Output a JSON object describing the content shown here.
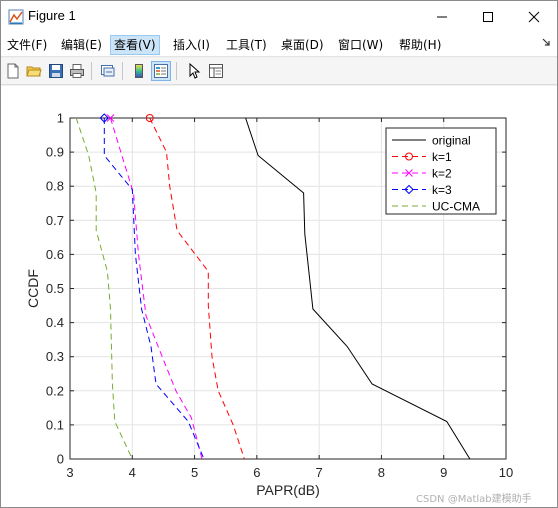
{
  "window": {
    "title": "Figure 1",
    "colors": {
      "title_bg": "#ffffff",
      "menu_active_bg": "#cce4f7"
    }
  },
  "menubar": {
    "items": [
      {
        "label": "文件(F)",
        "active": false
      },
      {
        "label": "编辑(E)",
        "active": false
      },
      {
        "label": "查看(V)",
        "active": true
      },
      {
        "label": "插入(I)",
        "active": false
      },
      {
        "label": "工具(T)",
        "active": false
      },
      {
        "label": "桌面(D)",
        "active": false
      },
      {
        "label": "窗口(W)",
        "active": false
      },
      {
        "label": "帮助(H)",
        "active": false
      }
    ],
    "overflow_icon": "dock-arrow-icon"
  },
  "toolbar": {
    "buttons": [
      {
        "icon": "new-figure-icon"
      },
      {
        "icon": "open-file-icon"
      },
      {
        "icon": "save-icon"
      },
      {
        "icon": "print-icon"
      },
      {
        "icon": "link-plot-icon"
      },
      {
        "icon": "colorbar-icon"
      },
      {
        "icon": "legend-icon",
        "pressed": true
      },
      {
        "icon": "pointer-icon"
      },
      {
        "icon": "property-inspector-icon"
      }
    ]
  },
  "chart_data": {
    "type": "line",
    "title": "",
    "xlabel": "PAPR(dB)",
    "ylabel": "CCDF",
    "xlim": [
      3,
      10
    ],
    "ylim": [
      0,
      1
    ],
    "xticks": [
      "3",
      "4",
      "5",
      "6",
      "7",
      "8",
      "9",
      "10"
    ],
    "yticks": [
      "0",
      "0.1",
      "0.2",
      "0.3",
      "0.4",
      "0.5",
      "0.6",
      "0.7",
      "0.8",
      "0.9",
      "1"
    ],
    "grid": true,
    "legend_position": "top-right",
    "series": [
      {
        "name": "original",
        "color": "#000000",
        "dash": "solid",
        "marker": "none",
        "x": [
          5.82,
          6.02,
          6.75,
          6.77,
          6.9,
          7.45,
          7.85,
          9.05,
          9.42
        ],
        "y": [
          1.0,
          0.89,
          0.78,
          0.66,
          0.44,
          0.33,
          0.22,
          0.11,
          0.0
        ]
      },
      {
        "name": "k=1",
        "color": "#ff0000",
        "dash": "dashed",
        "marker": "circle",
        "x": [
          4.28,
          4.55,
          4.6,
          4.72,
          5.22,
          5.22,
          5.28,
          5.38,
          5.62,
          5.8
        ],
        "y": [
          1.0,
          0.9,
          0.8,
          0.67,
          0.55,
          0.45,
          0.3,
          0.2,
          0.1,
          0.0
        ]
      },
      {
        "name": "k=2",
        "color": "#ff00ff",
        "dash": "dashed",
        "marker": "x",
        "x": [
          3.65,
          3.85,
          4.02,
          4.1,
          4.22,
          4.48,
          4.7,
          4.95,
          5.12
        ],
        "y": [
          1.0,
          0.88,
          0.78,
          0.6,
          0.42,
          0.3,
          0.2,
          0.12,
          0.0
        ]
      },
      {
        "name": "k=3",
        "color": "#0000ff",
        "dash": "dashed",
        "marker": "diamond",
        "x": [
          3.55,
          3.55,
          4.0,
          4.05,
          4.15,
          4.3,
          4.38,
          4.9,
          5.15
        ],
        "y": [
          1.0,
          0.89,
          0.79,
          0.6,
          0.44,
          0.33,
          0.22,
          0.11,
          0.0
        ]
      },
      {
        "name": "UC-CMA",
        "color": "#77ac30",
        "dash": "dashed",
        "marker": "none",
        "x": [
          3.1,
          3.3,
          3.42,
          3.42,
          3.6,
          3.65,
          3.68,
          3.72,
          4.0
        ],
        "y": [
          1.0,
          0.89,
          0.78,
          0.67,
          0.55,
          0.44,
          0.22,
          0.11,
          0.0
        ]
      }
    ]
  },
  "watermark": "CSDN @Matlab建模助手"
}
